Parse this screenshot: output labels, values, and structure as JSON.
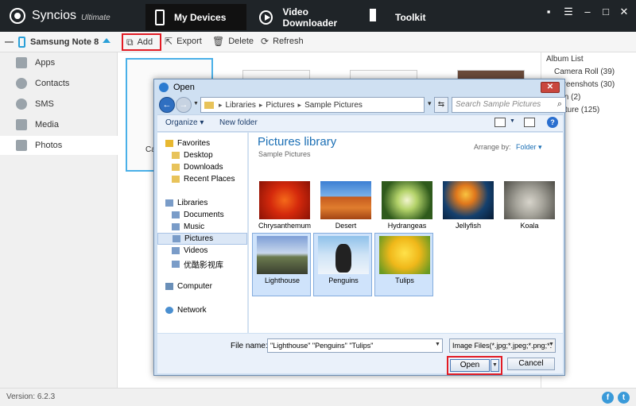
{
  "app": {
    "name": "Syncios",
    "edition": "Ultimate",
    "nav_tabs": [
      {
        "label": "My Devices",
        "active": true
      },
      {
        "label": "Video Downloader",
        "active": false
      },
      {
        "label": "Toolkit",
        "active": false
      }
    ],
    "window_controls": [
      "message-icon",
      "menu-icon",
      "minimize-icon",
      "maximize-icon",
      "close-icon"
    ]
  },
  "device": {
    "name": "Samsung Note 8"
  },
  "toolbar": {
    "add_label": "Add",
    "export_label": "Export",
    "delete_label": "Delete",
    "refresh_label": "Refresh"
  },
  "sidebar": {
    "items": [
      {
        "label": "Apps",
        "icon": "apps-icon"
      },
      {
        "label": "Contacts",
        "icon": "contacts-icon"
      },
      {
        "label": "SMS",
        "icon": "sms-icon"
      },
      {
        "label": "Media",
        "icon": "media-icon"
      },
      {
        "label": "Photos",
        "icon": "photos-icon",
        "active": true
      }
    ]
  },
  "main": {
    "thumb_caption": "Ca"
  },
  "album_list": {
    "title": "Album List",
    "items": [
      {
        "label": "Camera Roll (39)"
      },
      {
        "label": "Screenshots (30)"
      },
      {
        "label": "icon (2)"
      },
      {
        "label": "Picture (125)"
      }
    ]
  },
  "status": {
    "version": "Version: 6.2.3"
  },
  "dialog": {
    "title": "Open",
    "breadcrumb": [
      "Libraries",
      "Pictures",
      "Sample Pictures"
    ],
    "search_placeholder": "Search Sample Pictures",
    "organize_label": "Organize",
    "new_folder_label": "New folder",
    "nav": {
      "favorites_label": "Favorites",
      "favorites": [
        "Desktop",
        "Downloads",
        "Recent Places"
      ],
      "libraries_label": "Libraries",
      "libraries": [
        "Documents",
        "Music",
        "Pictures",
        "Videos",
        "优酷影视库"
      ],
      "computer_label": "Computer",
      "network_label": "Network"
    },
    "library_title": "Pictures library",
    "library_subtitle": "Sample Pictures",
    "arrange_label": "Arrange by:",
    "arrange_value": "Folder",
    "photos": [
      {
        "caption": "Chrysanthemum",
        "selected": false
      },
      {
        "caption": "Desert",
        "selected": false
      },
      {
        "caption": "Hydrangeas",
        "selected": false
      },
      {
        "caption": "Jellyfish",
        "selected": false
      },
      {
        "caption": "Koala",
        "selected": false
      },
      {
        "caption": "Lighthouse",
        "selected": true
      },
      {
        "caption": "Penguins",
        "selected": true
      },
      {
        "caption": "Tulips",
        "selected": true
      }
    ],
    "file_name_label": "File name:",
    "file_name_value": "\"Lighthouse\" \"Penguins\" \"Tulips\"",
    "file_type_value": "Image Files(*.jpg;*.jpeg;*.png;*.",
    "open_label": "Open",
    "cancel_label": "Cancel"
  }
}
